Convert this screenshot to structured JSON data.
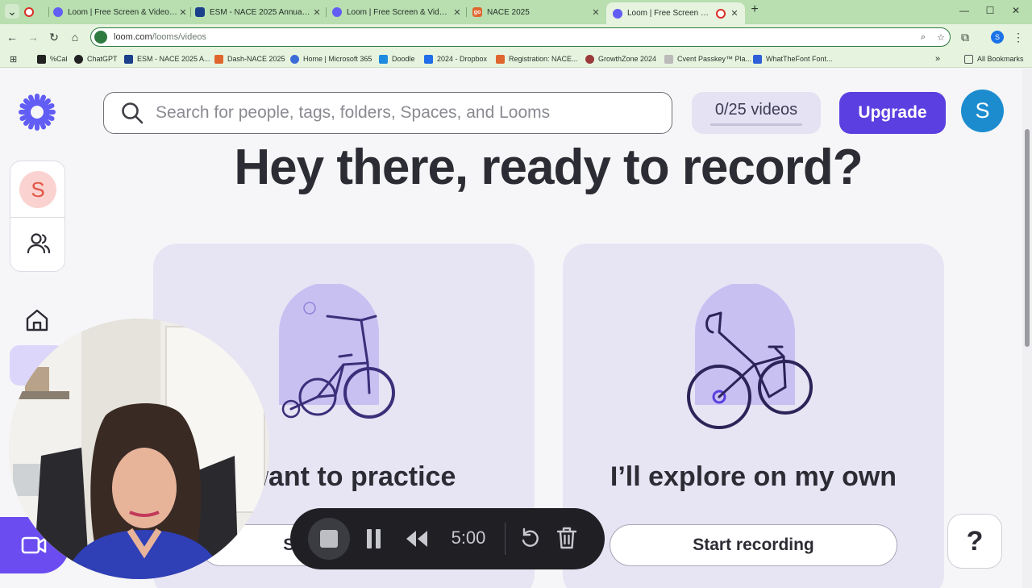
{
  "browser": {
    "tabs": [
      {
        "title": "",
        "favicon_color": "#d93025"
      },
      {
        "title": "Loom | Free Screen & Video Re",
        "favicon_color": "#625df5"
      },
      {
        "title": "ESM - NACE 2025 Annual Conf",
        "favicon_color": "#1a3f8b"
      },
      {
        "title": "Loom | Free Screen & Video Re",
        "favicon_color": "#625df5"
      },
      {
        "title": "NACE 2025",
        "favicon_color": "#e0662f"
      },
      {
        "title": "Loom | Free Screen & Video",
        "favicon_color": "#625df5"
      }
    ],
    "url_host": "loom.com",
    "url_path": "/looms/videos",
    "profile_initial": "S",
    "bookmarks": [
      {
        "label": "%Cal",
        "color": "#222"
      },
      {
        "label": "ChatGPT",
        "color": "#222"
      },
      {
        "label": "ESM - NACE 2025 A...",
        "color": "#1a3f8b"
      },
      {
        "label": "Dash-NACE 2025",
        "color": "#e0662f"
      },
      {
        "label": "Home | Microsoft 365",
        "color": "#3c6cd8"
      },
      {
        "label": "Doodle",
        "color": "#1f8be0"
      },
      {
        "label": "2024 - Dropbox",
        "color": "#1f6de8"
      },
      {
        "label": "Registration: NACE...",
        "color": "#e0662f"
      },
      {
        "label": "GrowthZone 2024",
        "color": "#9a3a3a"
      },
      {
        "label": "Cvent Passkey™ Pla...",
        "color": "#777"
      },
      {
        "label": "WhatTheFont Font...",
        "color": "#2f5fd8"
      }
    ],
    "all_bookmarks": "All Bookmarks"
  },
  "app": {
    "search_placeholder": "Search for people, tags, folders, Spaces, and Looms",
    "videos_count": "0/25 videos",
    "upgrade_label": "Upgrade",
    "user_initial": "S",
    "workspace_initial": "S",
    "headline": "Hey there, ready to record?",
    "cards": [
      {
        "title": "I want to practice",
        "button": "Start recording"
      },
      {
        "title": "I’ll explore on my own",
        "button": "Start recording"
      }
    ],
    "help_label": "?"
  },
  "recorder": {
    "time_remaining": "5:00"
  },
  "colors": {
    "accent": "#5b3fe0",
    "chrome_green": "#b9deb0"
  }
}
